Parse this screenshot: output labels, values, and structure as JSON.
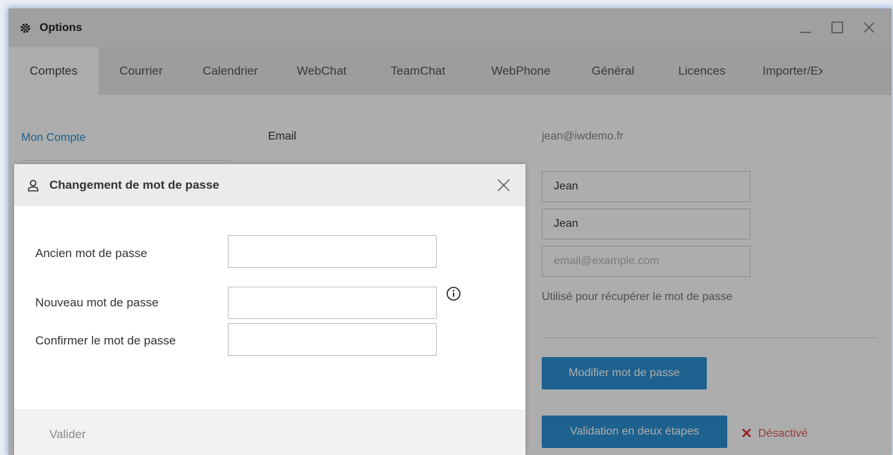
{
  "window": {
    "title": "Options",
    "icon": "gear-icon",
    "controls": [
      "minimize-icon",
      "maximize-icon",
      "close-icon"
    ]
  },
  "tabs": [
    {
      "label": "Comptes",
      "active": true
    },
    {
      "label": "Courrier",
      "active": false
    },
    {
      "label": "Calendrier",
      "active": false
    },
    {
      "label": "WebChat",
      "active": false
    },
    {
      "label": "TeamChat",
      "active": false
    },
    {
      "label": "WebPhone",
      "active": false
    },
    {
      "label": "Général",
      "active": false
    },
    {
      "label": "Licences",
      "active": false
    },
    {
      "label": "Importer/Ex",
      "active": false
    }
  ],
  "account": {
    "nav_link": "Mon Compte",
    "email_label": "Email",
    "email_value": "jean@iwdemo.fr",
    "first_name": "Jean",
    "last_name": "Jean",
    "recovery_placeholder": "email@example.com",
    "recovery_hint": "Utilisé pour récupérer le mot de passe",
    "change_password_button": "Modifier mot de passe",
    "two_step_button": "Validation en deux étapes",
    "two_step_status": "Désactivé"
  },
  "dialog": {
    "title": "Changement de mot de passe",
    "old_password_label": "Ancien mot de passe",
    "new_password_label": "Nouveau mot de passe",
    "confirm_password_label": "Confirmer le mot de passe",
    "submit_label": "Valider"
  },
  "colors": {
    "accent": "#2b8fd1",
    "link": "#2a8fce",
    "danger": "#e03c3c"
  }
}
